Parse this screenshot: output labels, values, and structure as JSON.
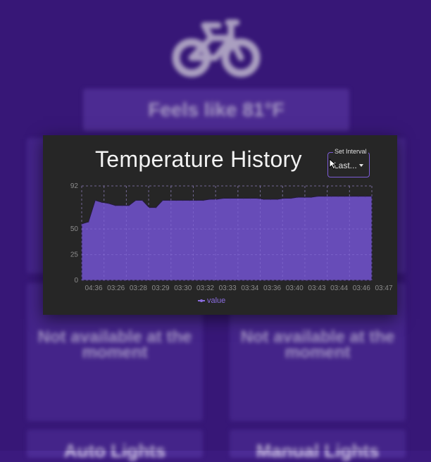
{
  "background": {
    "feels_like": "Feels like 81°F",
    "cards": [
      {
        "message": "Not available at the moment"
      },
      {
        "message": "Not available at the moment"
      }
    ],
    "bottom_cards": [
      {
        "label": "Auto Lights"
      },
      {
        "label": "Manual Lights"
      }
    ]
  },
  "dialog": {
    "title": "Temperature History",
    "interval": {
      "label": "Set Interval",
      "value": "Last..."
    },
    "legend": "value"
  },
  "colors": {
    "page_bg": "#3b1a7e",
    "dialog_bg": "#262626",
    "series_fill": "#6a4ec0",
    "accent": "#7c5cd6"
  },
  "chart_data": {
    "type": "area",
    "title": "Temperature History",
    "xlabel": "",
    "ylabel": "",
    "grid": true,
    "legend": "bottom",
    "y_ticks": [
      0,
      25,
      50,
      92
    ],
    "x_ticks": [
      "04:36",
      "03:26",
      "03:28",
      "03:29",
      "03:30",
      "03:32",
      "03:33",
      "03:34",
      "03:36",
      "03:40",
      "03:43",
      "03:44",
      "03:46",
      "03:47"
    ],
    "ylim": [
      0,
      92
    ],
    "series": [
      {
        "name": "value",
        "values": [
          55,
          57,
          78,
          76,
          75,
          73,
          73,
          73,
          78,
          78,
          71,
          71,
          78,
          78,
          78,
          78,
          78,
          78,
          78,
          79,
          79,
          80,
          80,
          80,
          80,
          80,
          80,
          79,
          79,
          79,
          80,
          80,
          81,
          81,
          81,
          82,
          82,
          82,
          82,
          82,
          82,
          82,
          82,
          82
        ]
      }
    ]
  }
}
